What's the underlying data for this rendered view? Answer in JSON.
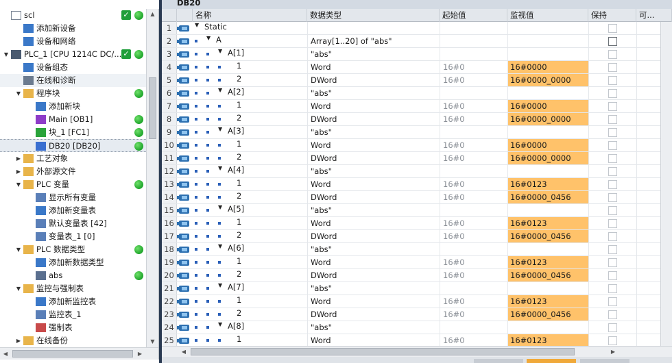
{
  "tree": {
    "items": [
      {
        "label": "scl",
        "level": 0,
        "expand": "",
        "icon": "document-icon",
        "check": true,
        "dot": true
      },
      {
        "label": "添加新设备",
        "level": 1,
        "expand": "",
        "icon": "add-device-icon"
      },
      {
        "label": "设备和网络",
        "level": 1,
        "expand": "",
        "icon": "network-icon"
      },
      {
        "label": "PLC_1 [CPU 1214C DC/...",
        "level": 0,
        "expand": "▼",
        "icon": "plc-icon",
        "check": true,
        "dot": true
      },
      {
        "label": "设备组态",
        "level": 1,
        "expand": "",
        "icon": "device-config-icon"
      },
      {
        "label": "在线和诊断",
        "level": 1,
        "expand": "",
        "icon": "diagnostics-icon",
        "hover": true
      },
      {
        "label": "程序块",
        "level": 1,
        "expand": "▼",
        "icon": "folder-icon",
        "dot": true
      },
      {
        "label": "添加新块",
        "level": 2,
        "expand": "",
        "icon": "add-block-icon"
      },
      {
        "label": "Main [OB1]",
        "level": 2,
        "expand": "",
        "icon": "ob-block-icon",
        "dot": true
      },
      {
        "label": "块_1 [FC1]",
        "level": 2,
        "expand": "",
        "icon": "fc-block-icon",
        "dot": true
      },
      {
        "label": "DB20 [DB20]",
        "level": 2,
        "expand": "",
        "icon": "db-block-icon",
        "dot": true,
        "selected": true
      },
      {
        "label": "工艺对象",
        "level": 1,
        "expand": "▶",
        "icon": "folder-icon"
      },
      {
        "label": "外部源文件",
        "level": 1,
        "expand": "▶",
        "icon": "folder-icon"
      },
      {
        "label": "PLC 变量",
        "level": 1,
        "expand": "▼",
        "icon": "folder-icon",
        "dot": true
      },
      {
        "label": "显示所有变量",
        "level": 2,
        "expand": "",
        "icon": "tag-table-icon"
      },
      {
        "label": "添加新变量表",
        "level": 2,
        "expand": "",
        "icon": "add-tag-table-icon"
      },
      {
        "label": "默认变量表 [42]",
        "level": 2,
        "expand": "",
        "icon": "tag-table-icon"
      },
      {
        "label": "变量表_1 [0]",
        "level": 2,
        "expand": "",
        "icon": "tag-table-icon"
      },
      {
        "label": "PLC 数据类型",
        "level": 1,
        "expand": "▼",
        "icon": "folder-icon",
        "dot": true
      },
      {
        "label": "添加新数据类型",
        "level": 2,
        "expand": "",
        "icon": "add-datatype-icon"
      },
      {
        "label": "abs",
        "level": 2,
        "expand": "",
        "icon": "datatype-icon",
        "dot": true
      },
      {
        "label": "监控与强制表",
        "level": 1,
        "expand": "▼",
        "icon": "folder-icon"
      },
      {
        "label": "添加新监控表",
        "level": 2,
        "expand": "",
        "icon": "add-watch-table-icon"
      },
      {
        "label": "监控表_1",
        "level": 2,
        "expand": "",
        "icon": "watch-table-icon"
      },
      {
        "label": "强制表",
        "level": 2,
        "expand": "",
        "icon": "force-table-icon"
      },
      {
        "label": "在线备份",
        "level": 1,
        "expand": "▶",
        "icon": "folder-icon"
      }
    ]
  },
  "editor": {
    "title": "DB20",
    "columns": {
      "name": "名称",
      "type": "数据类型",
      "start": "起始值",
      "monitor": "监视值",
      "retain": "保持",
      "visible": "可..."
    },
    "rows": [
      {
        "n": "1",
        "depth": 0,
        "expand": "▼",
        "name": "Static",
        "type": "",
        "start": "",
        "monitor": "",
        "retain": "empty",
        "vis": "empty"
      },
      {
        "n": "2",
        "depth": 1,
        "expand": "▼",
        "name": "A",
        "type": "Array[1..20] of \"abs\"",
        "start": "",
        "monitor": "",
        "retain": "dark",
        "vis": "checked"
      },
      {
        "n": "3",
        "depth": 2,
        "expand": "▼",
        "name": "A[1]",
        "type": "\"abs\"",
        "start": "",
        "monitor": "",
        "retain": "empty",
        "vis": "checked"
      },
      {
        "n": "4",
        "depth": 3,
        "expand": "",
        "name": "1",
        "type": "Word",
        "start": "16#0",
        "monitor": "16#0000",
        "retain": "empty",
        "vis": "checked"
      },
      {
        "n": "5",
        "depth": 3,
        "expand": "",
        "name": "2",
        "type": "DWord",
        "start": "16#0",
        "monitor": "16#0000_0000",
        "retain": "empty",
        "vis": "checked"
      },
      {
        "n": "6",
        "depth": 2,
        "expand": "▼",
        "name": "A[2]",
        "type": "\"abs\"",
        "start": "",
        "monitor": "",
        "retain": "empty",
        "vis": "checked"
      },
      {
        "n": "7",
        "depth": 3,
        "expand": "",
        "name": "1",
        "type": "Word",
        "start": "16#0",
        "monitor": "16#0000",
        "retain": "empty",
        "vis": "checked"
      },
      {
        "n": "8",
        "depth": 3,
        "expand": "",
        "name": "2",
        "type": "DWord",
        "start": "16#0",
        "monitor": "16#0000_0000",
        "retain": "empty",
        "vis": "checked"
      },
      {
        "n": "9",
        "depth": 2,
        "expand": "▼",
        "name": "A[3]",
        "type": "\"abs\"",
        "start": "",
        "monitor": "",
        "retain": "empty",
        "vis": "checked"
      },
      {
        "n": "10",
        "depth": 3,
        "expand": "",
        "name": "1",
        "type": "Word",
        "start": "16#0",
        "monitor": "16#0000",
        "retain": "empty",
        "vis": "checked"
      },
      {
        "n": "11",
        "depth": 3,
        "expand": "",
        "name": "2",
        "type": "DWord",
        "start": "16#0",
        "monitor": "16#0000_0000",
        "retain": "empty",
        "vis": "checked"
      },
      {
        "n": "12",
        "depth": 2,
        "expand": "▼",
        "name": "A[4]",
        "type": "\"abs\"",
        "start": "",
        "monitor": "",
        "retain": "empty",
        "vis": "checked"
      },
      {
        "n": "13",
        "depth": 3,
        "expand": "",
        "name": "1",
        "type": "Word",
        "start": "16#0",
        "monitor": "16#0123",
        "retain": "empty",
        "vis": "checked"
      },
      {
        "n": "14",
        "depth": 3,
        "expand": "",
        "name": "2",
        "type": "DWord",
        "start": "16#0",
        "monitor": "16#0000_0456",
        "retain": "empty",
        "vis": "checked"
      },
      {
        "n": "15",
        "depth": 2,
        "expand": "▼",
        "name": "A[5]",
        "type": "\"abs\"",
        "start": "",
        "monitor": "",
        "retain": "empty",
        "vis": "checked"
      },
      {
        "n": "16",
        "depth": 3,
        "expand": "",
        "name": "1",
        "type": "Word",
        "start": "16#0",
        "monitor": "16#0123",
        "retain": "empty",
        "vis": "checked"
      },
      {
        "n": "17",
        "depth": 3,
        "expand": "",
        "name": "2",
        "type": "DWord",
        "start": "16#0",
        "monitor": "16#0000_0456",
        "retain": "empty",
        "vis": "checked"
      },
      {
        "n": "18",
        "depth": 2,
        "expand": "▼",
        "name": "A[6]",
        "type": "\"abs\"",
        "start": "",
        "monitor": "",
        "retain": "empty",
        "vis": "checked"
      },
      {
        "n": "19",
        "depth": 3,
        "expand": "",
        "name": "1",
        "type": "Word",
        "start": "16#0",
        "monitor": "16#0123",
        "retain": "empty",
        "vis": "checked"
      },
      {
        "n": "20",
        "depth": 3,
        "expand": "",
        "name": "2",
        "type": "DWord",
        "start": "16#0",
        "monitor": "16#0000_0456",
        "retain": "empty",
        "vis": "checked"
      },
      {
        "n": "21",
        "depth": 2,
        "expand": "▼",
        "name": "A[7]",
        "type": "\"abs\"",
        "start": "",
        "monitor": "",
        "retain": "empty",
        "vis": "checked"
      },
      {
        "n": "22",
        "depth": 3,
        "expand": "",
        "name": "1",
        "type": "Word",
        "start": "16#0",
        "monitor": "16#0123",
        "retain": "empty",
        "vis": "checked"
      },
      {
        "n": "23",
        "depth": 3,
        "expand": "",
        "name": "2",
        "type": "DWord",
        "start": "16#0",
        "monitor": "16#0000_0456",
        "retain": "empty",
        "vis": "checked"
      },
      {
        "n": "24",
        "depth": 2,
        "expand": "▼",
        "name": "A[8]",
        "type": "\"abs\"",
        "start": "",
        "monitor": "",
        "retain": "empty",
        "vis": "checked"
      },
      {
        "n": "25",
        "depth": 3,
        "expand": "",
        "name": "1",
        "type": "Word",
        "start": "16#0",
        "monitor": "16#0123",
        "retain": "empty",
        "vis": "checked"
      }
    ]
  },
  "colors": {
    "accent_monitor": "#ffc26a",
    "status_ok": "#1fa52b",
    "splitter": "#2a3a52"
  }
}
